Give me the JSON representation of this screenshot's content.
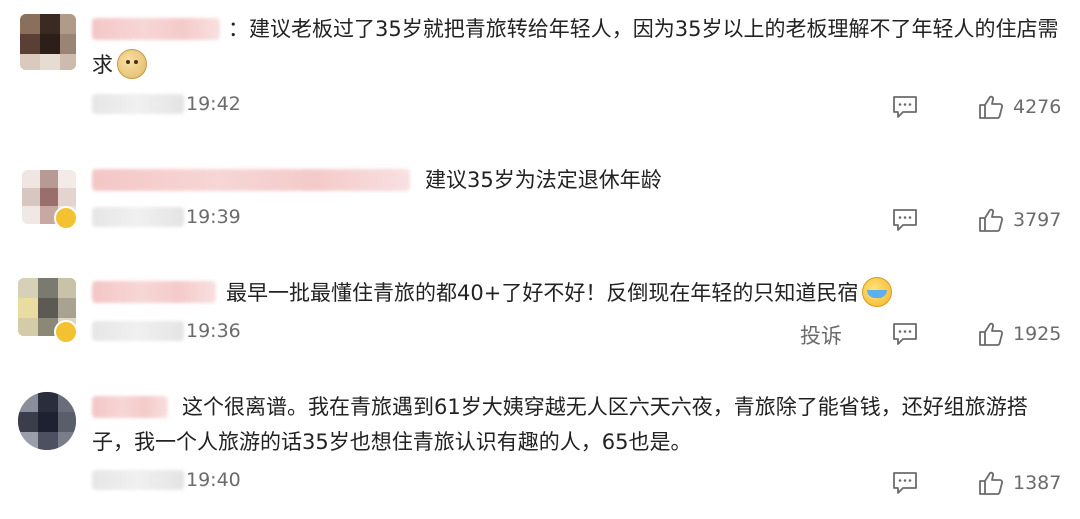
{
  "comments": [
    {
      "text_line1": "：建议老板过了35岁就把青旅转给年轻人，因为35岁以上的老板理解不了年轻人的住店需",
      "text_line2": "求",
      "emoji": "dog-face-emoji",
      "time": "19:42",
      "likes": "4276"
    },
    {
      "text_line1": "建议35岁为法定退休年龄",
      "time": "19:39",
      "likes": "3797"
    },
    {
      "text_line1": "最早一批最懂住青旅的都40+了好不好！反倒现在年轻的只知道民宿",
      "emoji": "crying-laughing-emoji",
      "time": "19:36",
      "report": "投诉",
      "likes": "1925"
    },
    {
      "text_line1": "这个很离谱。我在青旅遇到61岁大姨穿越无人区六天六夜，青旅除了能省钱，还好组旅游搭",
      "text_line2": "子，我一个人旅游的话35岁也想住青旅认识有趣的人，65也是。",
      "time": "19:40",
      "likes": "1387"
    }
  ],
  "icons": {
    "reply": "comment-icon",
    "like": "thumbs-up-icon"
  },
  "colors": {
    "text": "#222222",
    "meta": "#6b6b6b",
    "name_blur": "#f4c6c6"
  }
}
